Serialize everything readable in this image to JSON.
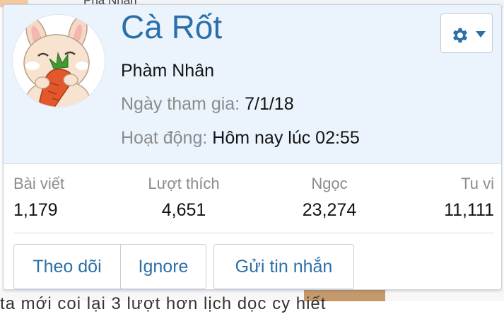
{
  "background": {
    "top_text": "Phá   Nhân",
    "bottom_text": "ta mới coi lại 3 lượt hơn lịch               dọc cy hiết"
  },
  "profile": {
    "username": "Cà Rốt",
    "user_title": "Phàm Nhân",
    "joined_label": "Ngày tham gia:",
    "joined_value": "7/1/18",
    "last_activity_label": "Hoạt động:",
    "last_activity_value": "Hôm nay lúc 02:55"
  },
  "stats": [
    {
      "label": "Bài viết",
      "value": "1,179"
    },
    {
      "label": "Lượt thích",
      "value": "4,651"
    },
    {
      "label": "Ngọc",
      "value": "23,274"
    },
    {
      "label": "Tu vi",
      "value": "11,111"
    }
  ],
  "actions": {
    "follow_label": "Theo dõi",
    "ignore_label": "Ignore",
    "message_label": "Gửi tin nhắn"
  },
  "icons": {
    "settings": "gear-icon",
    "dropdown": "caret-down-icon"
  },
  "colors": {
    "accent": "#2b6fa8",
    "header_bg": "#ebf3fc",
    "muted_text": "#8c8c8c"
  }
}
